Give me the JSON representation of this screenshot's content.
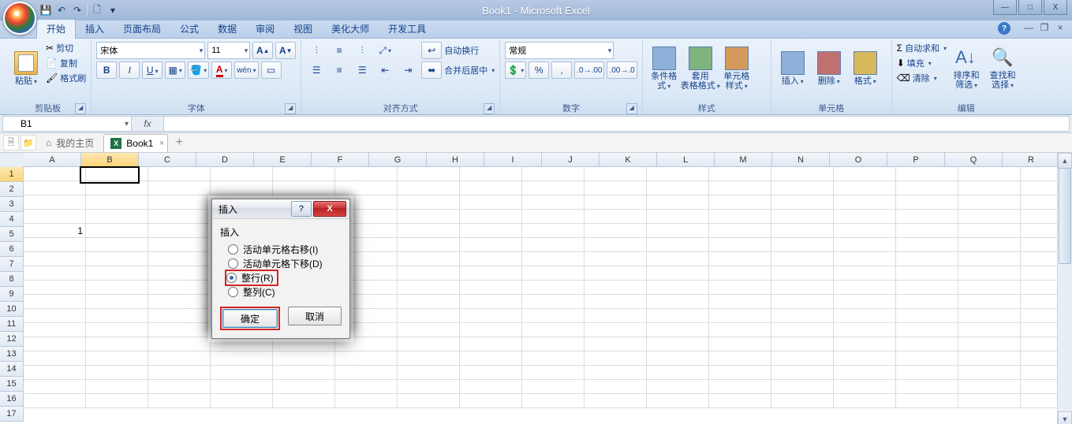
{
  "app_title": "Book1 - Microsoft Excel",
  "qat": {
    "save": "💾",
    "undo": "↶",
    "redo": "↷",
    "misc": "🗋",
    "dd": "▾"
  },
  "win": {
    "min": "—",
    "max": "□",
    "close": "X"
  },
  "tabs": {
    "home": "开始",
    "insert": "插入",
    "layout": "页面布局",
    "formula": "公式",
    "data": "数据",
    "review": "审阅",
    "view": "视图",
    "beauty": "美化大师",
    "dev": "开发工具"
  },
  "doc_ctrl": {
    "help": "?",
    "min": "—",
    "restore": "❐",
    "close": "×"
  },
  "ribbon": {
    "clipboard": {
      "paste": "粘贴",
      "cut": "剪切",
      "copy": "复制",
      "painter": "格式刷",
      "label": "剪贴板"
    },
    "font": {
      "name": "宋体",
      "size": "11",
      "label": "字体"
    },
    "align": {
      "wrap": "自动换行",
      "merge": "合并后居中",
      "label": "对齐方式"
    },
    "number": {
      "format": "常规",
      "label": "数字"
    },
    "styles": {
      "cond": "条件格式",
      "table": "套用\n表格格式",
      "cell": "单元格\n样式",
      "label": "样式"
    },
    "cells": {
      "insert": "插入",
      "delete": "删除",
      "format": "格式",
      "label": "单元格"
    },
    "edit": {
      "sum": "自动求和",
      "fill": "填充",
      "clear": "清除",
      "sort": "排序和\n筛选",
      "find": "查找和\n选择",
      "label": "编辑"
    }
  },
  "namebox": "B1",
  "fx_label": "fx",
  "doc_tabs": {
    "home": "我的主页",
    "book": "Book1"
  },
  "columns": [
    "A",
    "B",
    "C",
    "D",
    "E",
    "F",
    "G",
    "H",
    "I",
    "J",
    "K",
    "L",
    "M",
    "N",
    "O",
    "P",
    "Q",
    "R"
  ],
  "rows": [
    "1",
    "2",
    "3",
    "4",
    "5",
    "6",
    "7",
    "8",
    "9",
    "10",
    "11",
    "12",
    "13",
    "14",
    "15",
    "16",
    "17"
  ],
  "cell_a5": "1",
  "dialog": {
    "title": "插入",
    "group": "插入",
    "opt_right": "活动单元格右移(I)",
    "opt_down": "活动单元格下移(D)",
    "opt_row": "整行(R)",
    "opt_col": "整列(C)",
    "ok": "确定",
    "cancel": "取消"
  }
}
